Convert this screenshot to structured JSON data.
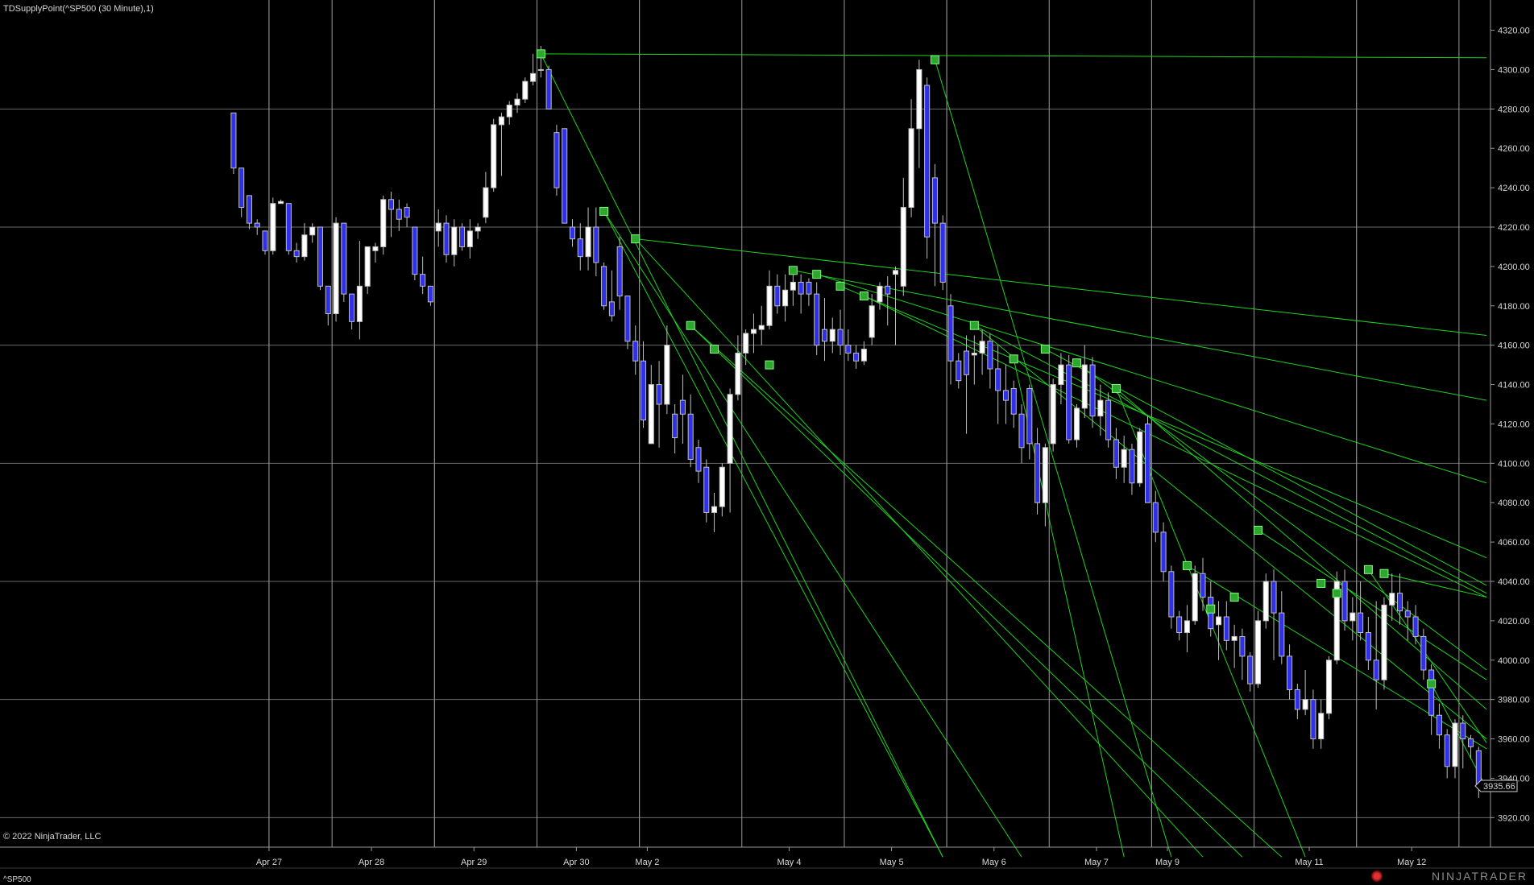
{
  "title": "TDSupplyPoint(^SP500 (30 Minute),1)",
  "copyright": "© 2022 NinjaTrader, LLC",
  "instrument": "^SP500",
  "logo_text": "NINJATRADER",
  "price_label": "3935.66",
  "chart_data": {
    "type": "candlestick",
    "ylim": [
      3905,
      4328
    ],
    "y_ticks": [
      3920,
      3940,
      3960,
      3980,
      4000,
      4020,
      4040,
      4060,
      4080,
      4100,
      4120,
      4140,
      4160,
      4180,
      4200,
      4220,
      4240,
      4260,
      4280,
      4300,
      4320
    ],
    "y_tick_labels": [
      "3920.00",
      "3940.00",
      "3960.00",
      "3980.00",
      "4000.00",
      "4020.00",
      "4040.00",
      "4060.00",
      "4080.00",
      "4100.00",
      "4120.00",
      "4140.00",
      "4160.00",
      "4180.00",
      "4200.00",
      "4220.00",
      "4240.00",
      "4260.00",
      "4280.00",
      "4300.00",
      "4320.00"
    ],
    "y_grid": [
      3920,
      3980,
      4040,
      4100,
      4160,
      4220,
      4280
    ],
    "x_ticks": [
      {
        "label": "Apr 27",
        "bar": 4.5
      },
      {
        "label": "Apr 28",
        "bar": 17.5
      },
      {
        "label": "Apr 29",
        "bar": 30.5
      },
      {
        "label": "Apr 30",
        "bar": 43.5
      },
      {
        "label": "May 2",
        "bar": 52.5
      },
      {
        "label": "May 4",
        "bar": 70.5
      },
      {
        "label": "May 5",
        "bar": 83.5
      },
      {
        "label": "May 6",
        "bar": 96.5
      },
      {
        "label": "May 7",
        "bar": 109.5
      },
      {
        "label": "May 9",
        "bar": 118.5
      },
      {
        "label": "May 11",
        "bar": 136.5
      },
      {
        "label": "May 12",
        "bar": 149.5
      }
    ],
    "separators": [
      4.5,
      12.5,
      25.5,
      38.5,
      51.5,
      64.5,
      77.5,
      90.5,
      103.5,
      116.5,
      129.5,
      142.5,
      155.5,
      168.5
    ],
    "gridlines_vertical": [
      4.5,
      25.5,
      51.5,
      90.5,
      116.5,
      142.5
    ],
    "total_bars": 160,
    "ohlc": [
      [
        4278,
        4278,
        4247,
        4250
      ],
      [
        4250,
        4250,
        4225,
        4230
      ],
      [
        4236,
        4236,
        4219,
        4222
      ],
      [
        4222,
        4224,
        4216,
        4220
      ],
      [
        4218,
        4218,
        4206,
        4208
      ],
      [
        4208,
        4235,
        4206,
        4232
      ],
      [
        4232,
        4234,
        4232,
        4233
      ],
      [
        4232,
        4232,
        4206,
        4208
      ],
      [
        4208,
        4212,
        4202,
        4205
      ],
      [
        4205,
        4222,
        4203,
        4216
      ],
      [
        4216,
        4222,
        4212,
        4220
      ],
      [
        4220,
        4220,
        4188,
        4190
      ],
      [
        4190,
        4190,
        4170,
        4176
      ],
      [
        4176,
        4225,
        4172,
        4222
      ],
      [
        4222,
        4222,
        4182,
        4186
      ],
      [
        4186,
        4186,
        4168,
        4172
      ],
      [
        4172,
        4213,
        4163,
        4190
      ],
      [
        4190,
        4210,
        4186,
        4210
      ],
      [
        4208,
        4212,
        4202,
        4210
      ],
      [
        4210,
        4236,
        4206,
        4234
      ],
      [
        4234,
        4238,
        4215,
        4229
      ],
      [
        4229,
        4234,
        4218,
        4224
      ],
      [
        4230,
        4232,
        4220,
        4225
      ],
      [
        4220,
        4220,
        4193,
        4196
      ],
      [
        4196,
        4205,
        4186,
        4190
      ],
      [
        4190,
        4190,
        4180,
        4182
      ],
      [
        4218,
        4229,
        4210,
        4222
      ],
      [
        4222,
        4226,
        4202,
        4206
      ],
      [
        4206,
        4224,
        4200,
        4220
      ],
      [
        4220,
        4222,
        4208,
        4210
      ],
      [
        4210,
        4224,
        4204,
        4218
      ],
      [
        4218,
        4222,
        4214,
        4220
      ],
      [
        4225,
        4248,
        4222,
        4240
      ],
      [
        4240,
        4275,
        4238,
        4272
      ],
      [
        4272,
        4278,
        4246,
        4276
      ],
      [
        4276,
        4284,
        4272,
        4282
      ],
      [
        4282,
        4288,
        4278,
        4285
      ],
      [
        4285,
        4296,
        4283,
        4294
      ],
      [
        4294,
        4308,
        4292,
        4298
      ],
      [
        4300,
        4312,
        4296,
        4300
      ],
      [
        4300,
        4302,
        4284,
        4280
      ],
      [
        4268,
        4272,
        4236,
        4240
      ],
      [
        4270,
        4270,
        4228,
        4222
      ],
      [
        4220,
        4224,
        4210,
        4214
      ],
      [
        4214,
        4222,
        4198,
        4205
      ],
      [
        4205,
        4230,
        4198,
        4220
      ],
      [
        4220,
        4230,
        4195,
        4202
      ],
      [
        4200,
        4202,
        4178,
        4180
      ],
      [
        4182,
        4198,
        4172,
        4175
      ],
      [
        4210,
        4215,
        4178,
        4185
      ],
      [
        4185,
        4185,
        4158,
        4162
      ],
      [
        4162,
        4170,
        4145,
        4152
      ],
      [
        4152,
        4162,
        4118,
        4122
      ],
      [
        4110,
        4150,
        4112,
        4140
      ],
      [
        4140,
        4152,
        4108,
        4130
      ],
      [
        4130,
        4170,
        4125,
        4160
      ],
      [
        4125,
        4130,
        4105,
        4113
      ],
      [
        4132,
        4145,
        4110,
        4125
      ],
      [
        4125,
        4135,
        4098,
        4102
      ],
      [
        4108,
        4112,
        4090,
        4096
      ],
      [
        4098,
        4102,
        4070,
        4075
      ],
      [
        4075,
        4085,
        4065,
        4078
      ],
      [
        4078,
        4100,
        4073,
        4098
      ],
      [
        4100,
        4138,
        4075,
        4135
      ],
      [
        4135,
        4165,
        4132,
        4156
      ],
      [
        4156,
        4168,
        4150,
        4166
      ],
      [
        4166,
        4176,
        4156,
        4168
      ],
      [
        4168,
        4180,
        4160,
        4170
      ],
      [
        4170,
        4198,
        4168,
        4190
      ],
      [
        4190,
        4196,
        4176,
        4180
      ],
      [
        4180,
        4196,
        4172,
        4188
      ],
      [
        4188,
        4200,
        4180,
        4192
      ],
      [
        4192,
        4196,
        4176,
        4186
      ],
      [
        4192,
        4194,
        4180,
        4186
      ],
      [
        4186,
        4192,
        4155,
        4160
      ],
      [
        4168,
        4184,
        4152,
        4162
      ],
      [
        4162,
        4174,
        4156,
        4168
      ],
      [
        4168,
        4178,
        4155,
        4160
      ],
      [
        4160,
        4168,
        4152,
        4156
      ],
      [
        4156,
        4160,
        4148,
        4152
      ],
      [
        4152,
        4162,
        4150,
        4158
      ],
      [
        4164,
        4186,
        4160,
        4180
      ],
      [
        4182,
        4192,
        4178,
        4190
      ],
      [
        4190,
        4195,
        4170,
        4186
      ],
      [
        4196,
        4200,
        4160,
        4198
      ],
      [
        4190,
        4245,
        4185,
        4230
      ],
      [
        4230,
        4285,
        4225,
        4270
      ],
      [
        4270,
        4305,
        4250,
        4300
      ],
      [
        4292,
        4296,
        4204,
        4215
      ],
      [
        4245,
        4252,
        4190,
        4222
      ],
      [
        4222,
        4226,
        4188,
        4192
      ],
      [
        4180,
        4186,
        4140,
        4152
      ],
      [
        4152,
        4156,
        4138,
        4142
      ],
      [
        4157,
        4165,
        4115,
        4145
      ],
      [
        4155,
        4165,
        4140,
        4156
      ],
      [
        4156,
        4168,
        4145,
        4162
      ],
      [
        4162,
        4166,
        4138,
        4148
      ],
      [
        4148,
        4160,
        4120,
        4137
      ],
      [
        4137,
        4150,
        4120,
        4132
      ],
      [
        4138,
        4142,
        4118,
        4125
      ],
      [
        4125,
        4130,
        4100,
        4108
      ],
      [
        4138,
        4140,
        4102,
        4110
      ],
      [
        4110,
        4118,
        4074,
        4080
      ],
      [
        4080,
        4110,
        4068,
        4108
      ],
      [
        4110,
        4143,
        4106,
        4140
      ],
      [
        4140,
        4156,
        4130,
        4150
      ],
      [
        4150,
        4155,
        4110,
        4112
      ],
      [
        4112,
        4130,
        4108,
        4128
      ],
      [
        4128,
        4160,
        4123,
        4150
      ],
      [
        4150,
        4154,
        4118,
        4124
      ],
      [
        4124,
        4140,
        4114,
        4132
      ],
      [
        4132,
        4136,
        4108,
        4112
      ],
      [
        4112,
        4118,
        4092,
        4098
      ],
      [
        4098,
        4114,
        4090,
        4107
      ],
      [
        4107,
        4110,
        4084,
        4090
      ],
      [
        4090,
        4118,
        4088,
        4116
      ],
      [
        4120,
        4124,
        4082,
        4080
      ],
      [
        4080,
        4086,
        4060,
        4065
      ],
      [
        4065,
        4070,
        4040,
        4045
      ],
      [
        4045,
        4048,
        4016,
        4022
      ],
      [
        4022,
        4025,
        4010,
        4014
      ],
      [
        4014,
        4028,
        4004,
        4020
      ],
      [
        4020,
        4048,
        4018,
        4044
      ],
      [
        4044,
        4052,
        4025,
        4032
      ],
      [
        4032,
        4040,
        4012,
        4016
      ],
      [
        4018,
        4030,
        4000,
        4022
      ],
      [
        4022,
        4030,
        4005,
        4010
      ],
      [
        4010,
        4018,
        3996,
        4012
      ],
      [
        4012,
        4016,
        3990,
        4002
      ],
      [
        4002,
        4004,
        3984,
        3988
      ],
      [
        3988,
        4025,
        3986,
        4020
      ],
      [
        4020,
        4044,
        4016,
        4040
      ],
      [
        4040,
        4046,
        4000,
        4024
      ],
      [
        4024,
        4035,
        3998,
        4002
      ],
      [
        4002,
        4008,
        3980,
        3985
      ],
      [
        3985,
        3988,
        3970,
        3975
      ],
      [
        3975,
        3995,
        3972,
        3980
      ],
      [
        3980,
        3985,
        3955,
        3960
      ],
      [
        3960,
        3980,
        3955,
        3973
      ],
      [
        3973,
        4002,
        3970,
        4000
      ],
      [
        4000,
        4045,
        3998,
        4040
      ],
      [
        4040,
        4046,
        4015,
        4020
      ],
      [
        4020,
        4032,
        4010,
        4024
      ],
      [
        4024,
        4040,
        4010,
        4014
      ],
      [
        4014,
        4022,
        3995,
        4000
      ],
      [
        4000,
        4030,
        3975,
        3990
      ],
      [
        3990,
        4032,
        3985,
        4028
      ],
      [
        4028,
        4044,
        4020,
        4034
      ],
      [
        4034,
        4044,
        4018,
        4025
      ],
      [
        4025,
        4030,
        4010,
        4022
      ],
      [
        4022,
        4028,
        4008,
        4012
      ],
      [
        4012,
        4016,
        3990,
        3995
      ],
      [
        3995,
        3998,
        3962,
        3972
      ],
      [
        3972,
        3978,
        3955,
        3962
      ],
      [
        3962,
        3965,
        3940,
        3946
      ],
      [
        3946,
        3970,
        3940,
        3968
      ],
      [
        3968,
        3972,
        3945,
        3960
      ],
      [
        3960,
        3962,
        3950,
        3956
      ],
      [
        3954,
        3956,
        3930,
        3936
      ]
    ],
    "supply_points": [
      {
        "bar": 39,
        "price": 4308
      },
      {
        "bar": 47,
        "price": 4228
      },
      {
        "bar": 51,
        "price": 4214
      },
      {
        "bar": 58,
        "price": 4170
      },
      {
        "bar": 61,
        "price": 4158
      },
      {
        "bar": 68,
        "price": 4150
      },
      {
        "bar": 71,
        "price": 4198
      },
      {
        "bar": 74,
        "price": 4196
      },
      {
        "bar": 77,
        "price": 4190
      },
      {
        "bar": 80,
        "price": 4185
      },
      {
        "bar": 89,
        "price": 4305
      },
      {
        "bar": 94,
        "price": 4170
      },
      {
        "bar": 99,
        "price": 4153
      },
      {
        "bar": 103,
        "price": 4158
      },
      {
        "bar": 107,
        "price": 4151
      },
      {
        "bar": 112,
        "price": 4138
      },
      {
        "bar": 121,
        "price": 4048
      },
      {
        "bar": 124,
        "price": 4026
      },
      {
        "bar": 127,
        "price": 4032
      },
      {
        "bar": 130,
        "price": 4066
      },
      {
        "bar": 138,
        "price": 4039
      },
      {
        "bar": 140,
        "price": 4034
      },
      {
        "bar": 144,
        "price": 4046
      },
      {
        "bar": 146,
        "price": 4044
      },
      {
        "bar": 152,
        "price": 3988
      }
    ],
    "trend_lines": [
      {
        "from": [
          39,
          4308
        ],
        "to": [
          159,
          4306
        ]
      },
      {
        "from": [
          39,
          4308
        ],
        "to": [
          90,
          3900
        ]
      },
      {
        "from": [
          47,
          4228
        ],
        "to": [
          90,
          3900
        ]
      },
      {
        "from": [
          47,
          4228
        ],
        "to": [
          100,
          3900
        ]
      },
      {
        "from": [
          51,
          4214
        ],
        "to": [
          159,
          4165
        ]
      },
      {
        "from": [
          51,
          4214
        ],
        "to": [
          123,
          3900
        ]
      },
      {
        "from": [
          58,
          4170
        ],
        "to": [
          128,
          3900
        ]
      },
      {
        "from": [
          58,
          4170
        ],
        "to": [
          133,
          3900
        ]
      },
      {
        "from": [
          71,
          4198
        ],
        "to": [
          159,
          4132
        ]
      },
      {
        "from": [
          74,
          4196
        ],
        "to": [
          159,
          4090
        ]
      },
      {
        "from": [
          77,
          4190
        ],
        "to": [
          159,
          4052
        ]
      },
      {
        "from": [
          80,
          4185
        ],
        "to": [
          159,
          4032
        ]
      },
      {
        "from": [
          89,
          4305
        ],
        "to": [
          119,
          3900
        ]
      },
      {
        "from": [
          94,
          4170
        ],
        "to": [
          159,
          4034
        ]
      },
      {
        "from": [
          94,
          4170
        ],
        "to": [
          159,
          3960
        ]
      },
      {
        "from": [
          99,
          4153
        ],
        "to": [
          113,
          3900
        ]
      },
      {
        "from": [
          103,
          4158
        ],
        "to": [
          159,
          4038
        ]
      },
      {
        "from": [
          107,
          4151
        ],
        "to": [
          159,
          3995
        ]
      },
      {
        "from": [
          112,
          4138
        ],
        "to": [
          159,
          3975
        ]
      },
      {
        "from": [
          112,
          4138
        ],
        "to": [
          136,
          3900
        ]
      },
      {
        "from": [
          121,
          4048
        ],
        "to": [
          159,
          3955
        ]
      },
      {
        "from": [
          130,
          4066
        ],
        "to": [
          159,
          3990
        ]
      },
      {
        "from": [
          144,
          4046
        ],
        "to": [
          159,
          3958
        ]
      },
      {
        "from": [
          146,
          4044
        ],
        "to": [
          159,
          4032
        ]
      },
      {
        "from": [
          152,
          3988
        ],
        "to": [
          159,
          3935
        ]
      }
    ]
  }
}
